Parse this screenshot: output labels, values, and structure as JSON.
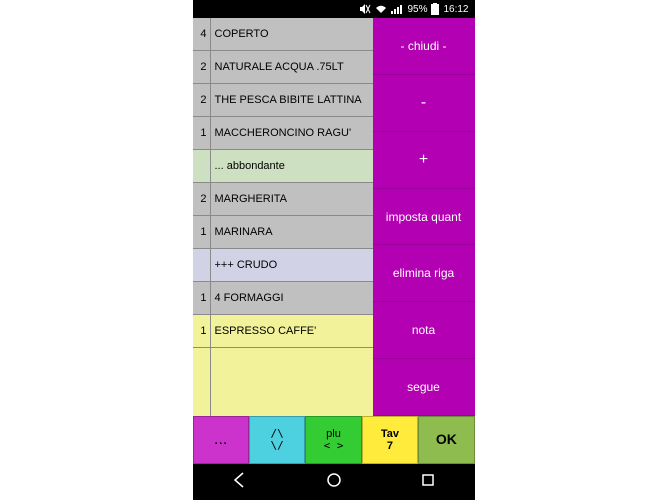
{
  "statusbar": {
    "battery_text": "95%",
    "time": "16:12"
  },
  "order": {
    "rows": [
      {
        "qty": "4",
        "name": "COPERTO",
        "kind": "item"
      },
      {
        "qty": "2",
        "name": "NATURALE ACQUA .75LT",
        "kind": "item"
      },
      {
        "qty": "2",
        "name": "THE PESCA BIBITE LATTINA",
        "kind": "item"
      },
      {
        "qty": "1",
        "name": "MACCHERONCINO RAGU'",
        "kind": "item"
      },
      {
        "qty": "",
        "name": "... abbondante",
        "kind": "note"
      },
      {
        "qty": "2",
        "name": "MARGHERITA",
        "kind": "item"
      },
      {
        "qty": "1",
        "name": "MARINARA",
        "kind": "item"
      },
      {
        "qty": "",
        "name": "+++ CRUDO",
        "kind": "addon"
      },
      {
        "qty": "1",
        "name": "4 FORMAGGI",
        "kind": "item"
      },
      {
        "qty": "1",
        "name": "ESPRESSO CAFFE'",
        "kind": "selected"
      }
    ]
  },
  "side": {
    "close": "- chiudi -",
    "minus": "-",
    "plus": "+",
    "set_qty": "imposta quant",
    "delete_row": "elimina riga",
    "note": "nota",
    "follows": "segue"
  },
  "bottom": {
    "more": "...",
    "up": "/\\",
    "down": "\\/",
    "plu": "plu",
    "nav": "< >",
    "table_label": "Tav",
    "table_num": "7",
    "ok": "OK"
  },
  "icons": {
    "mute": "mute-icon",
    "wifi": "wifi-icon",
    "signal": "signal-icon",
    "battery": "battery-icon",
    "back": "back-icon",
    "home": "home-icon",
    "recent": "recent-icon"
  }
}
